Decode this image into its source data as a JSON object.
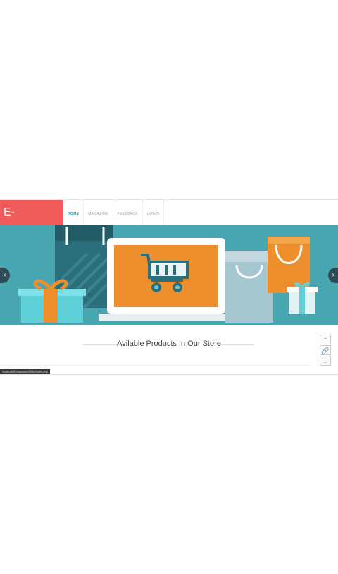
{
  "brand": {
    "logo_text": "E-Magazine"
  },
  "nav": {
    "items": [
      {
        "label": "HOME",
        "active": true
      },
      {
        "label": "MAGAZINE",
        "active": false
      },
      {
        "label": "FEEDBACK",
        "active": false
      },
      {
        "label": "LOGIN",
        "active": false
      }
    ]
  },
  "hero": {
    "prev_glyph": "‹",
    "next_glyph": "›",
    "colors": {
      "background": "#48a6b1",
      "accent": "#ef5b5b",
      "orange": "#ee8f2d"
    }
  },
  "products": {
    "title": "Avilable Products In Our Store"
  },
  "tools": {
    "up": "⌃",
    "link": "🔗",
    "down": "⌄"
  },
  "status": {
    "url": "localhost/Emagazine/User/index.php"
  }
}
